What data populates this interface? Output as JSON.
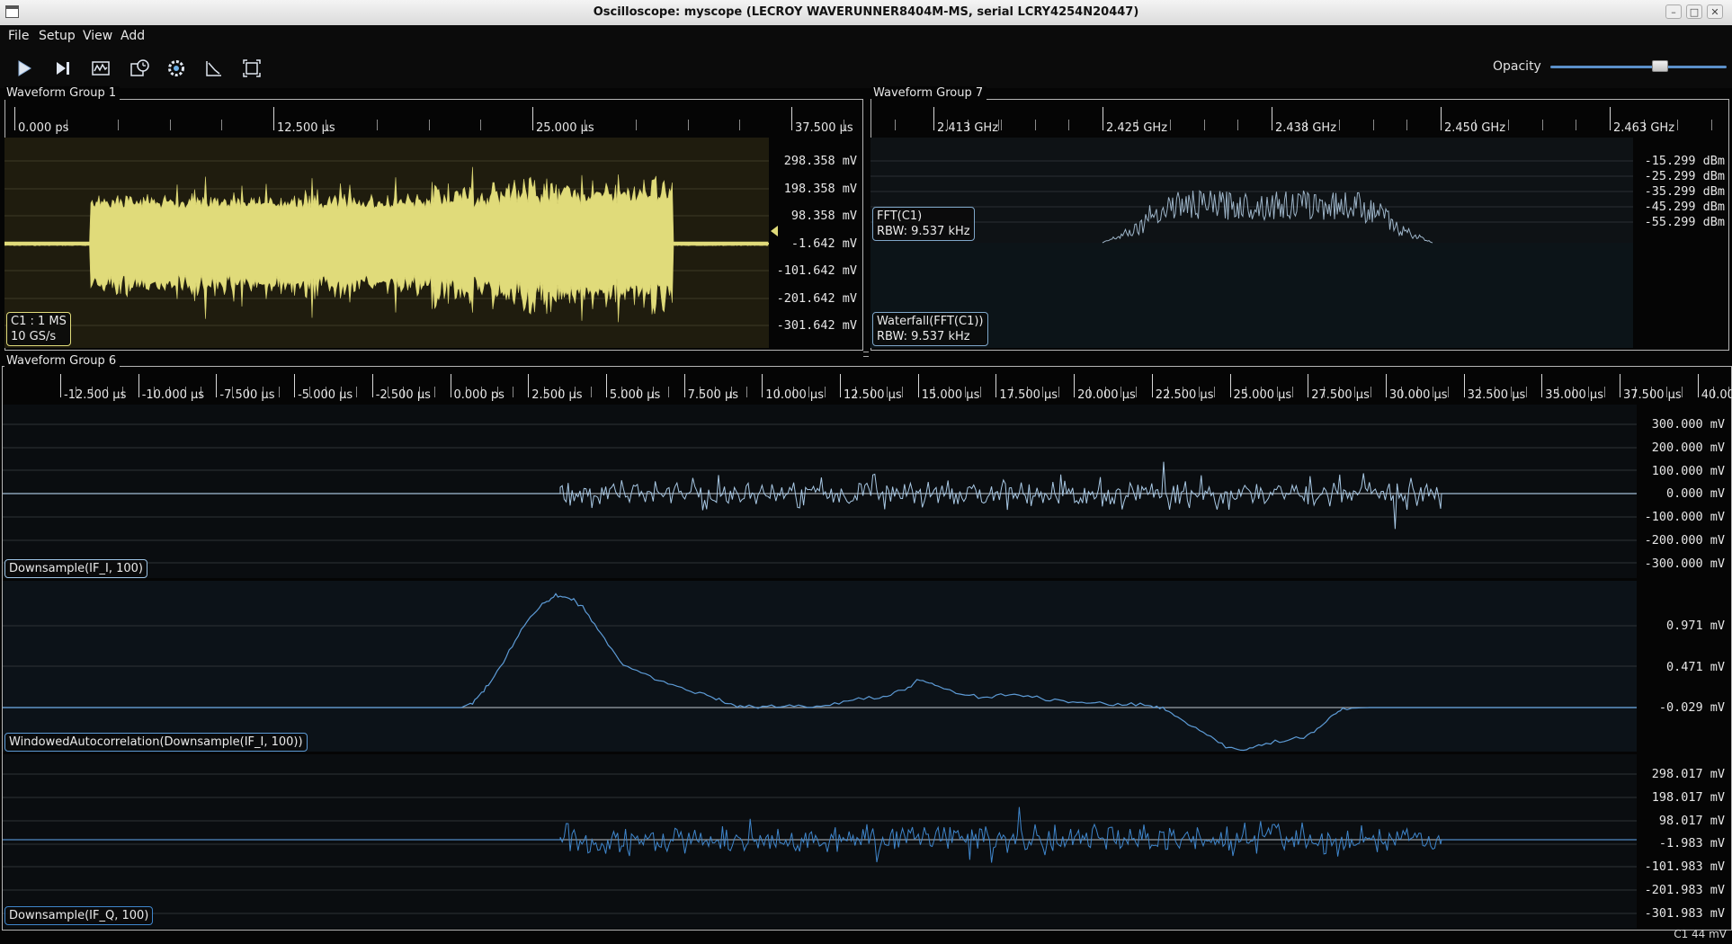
{
  "window": {
    "title": "Oscilloscope: myscope (LECROY WAVERUNNER8404M-MS, serial LCRY4254N20447)"
  },
  "menu": [
    "File",
    "Setup",
    "View",
    "Add"
  ],
  "toolbar": {
    "buttons": [
      "play-icon",
      "step-icon",
      "waveform-icon",
      "clock-history-icon",
      "gear-icon",
      "fit-icon",
      "fullscreen-icon"
    ],
    "opacity_label": "Opacity",
    "opacity_value": 0.62
  },
  "groups": {
    "g1": {
      "title": "Waveform Group 1",
      "xticks": [
        "0.000 ps",
        "12.500 μs",
        "25.000 μs",
        "37.500 μs"
      ],
      "yticks": [
        "298.358 mV",
        "198.358 mV",
        "98.358 mV",
        "-1.642 mV",
        "-101.642 mV",
        "-201.642 mV",
        "-301.642 mV"
      ],
      "channel": {
        "line1": "C1 : 1 MS",
        "line2": "10 GS/s",
        "color": "#e0db7a"
      }
    },
    "g7": {
      "title": "Waveform Group 7",
      "xticks": [
        "2.413 GHz",
        "2.425 GHz",
        "2.438 GHz",
        "2.450 GHz",
        "2.463 GHz"
      ],
      "yticks": [
        "-15.299 dBm",
        "-25.299 dBm",
        "-35.299 dBm",
        "-45.299 dBm",
        "-55.299 dBm"
      ],
      "fft": {
        "line1": "FFT(C1)",
        "line2": "RBW: 9.537 kHz"
      },
      "waterfall": {
        "line1": "Waterfall(FFT(C1))",
        "line2": "RBW: 9.537 kHz"
      }
    },
    "g6": {
      "title": "Waveform Group 6",
      "xticks": [
        "-12.500 μs",
        "-10.000 μs",
        "-7.500 μs",
        "-5.000 μs",
        "-2.500 μs",
        "0.000 ps",
        "2.500 μs",
        "5.000 μs",
        "7.500 μs",
        "10.000 μs",
        "12.500 μs",
        "15.000 μs",
        "17.500 μs",
        "20.000 μs",
        "22.500 μs",
        "25.000 μs",
        "27.500 μs",
        "30.000 μs",
        "32.500 μs",
        "35.000 μs",
        "37.500 μs",
        "40.00"
      ],
      "pane1": {
        "label": "Downsample(IF_I, 100)",
        "yticks": [
          "300.000 mV",
          "200.000 mV",
          "100.000 mV",
          "0.000 mV",
          "-100.000 mV",
          "-200.000 mV",
          "-300.000 mV"
        ]
      },
      "pane2": {
        "label": "WindowedAutocorrelation(Downsample(IF_I, 100))",
        "yticks": [
          "0.971 mV",
          "0.471 mV",
          "-0.029 mV"
        ]
      },
      "pane3": {
        "label": "Downsample(IF_Q, 100)",
        "yticks": [
          "298.017 mV",
          "198.017 mV",
          "98.017 mV",
          "-1.983 mV",
          "-101.983 mV",
          "-201.983 mV",
          "-301.983 mV"
        ]
      }
    }
  },
  "status": "C1 44 mV",
  "colors": {
    "yellow": "#e0db7a",
    "blue": "#5d9bd6",
    "pale_blue": "#9cc3e4",
    "grid": "#3a3a3a"
  }
}
